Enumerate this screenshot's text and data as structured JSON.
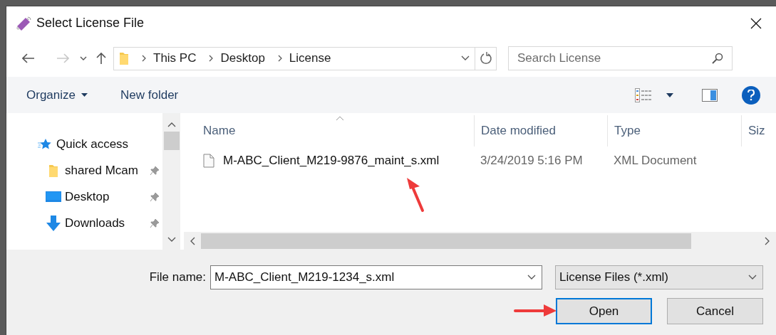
{
  "window": {
    "title": "Select License File"
  },
  "breadcrumb": [
    "This PC",
    "Desktop",
    "License"
  ],
  "search": {
    "placeholder": "Search License"
  },
  "toolbar": {
    "organize": "Organize",
    "new_folder": "New folder"
  },
  "sidebar": {
    "items": [
      {
        "kind": "quick-access",
        "label": "Quick access",
        "pinned": false
      },
      {
        "kind": "folder",
        "label": "shared Mcam",
        "pinned": true
      },
      {
        "kind": "desktop",
        "label": "Desktop",
        "pinned": true
      },
      {
        "kind": "downloads",
        "label": "Downloads",
        "pinned": true
      }
    ]
  },
  "table": {
    "columns": [
      "Name",
      "Date modified",
      "Type",
      "Siz"
    ],
    "rows": [
      {
        "name": "M-ABC_Client_M219-9876_maint_s.xml",
        "date": "3/24/2019 5:16 PM",
        "type": "XML Document"
      }
    ]
  },
  "file_name": {
    "label": "File name:",
    "value": "M-ABC_Client_M219-1234_s.xml"
  },
  "file_type": {
    "value": "License Files (*.xml)"
  },
  "buttons": [
    {
      "label": "Open",
      "default": true
    },
    {
      "label": "Cancel",
      "default": false
    }
  ]
}
